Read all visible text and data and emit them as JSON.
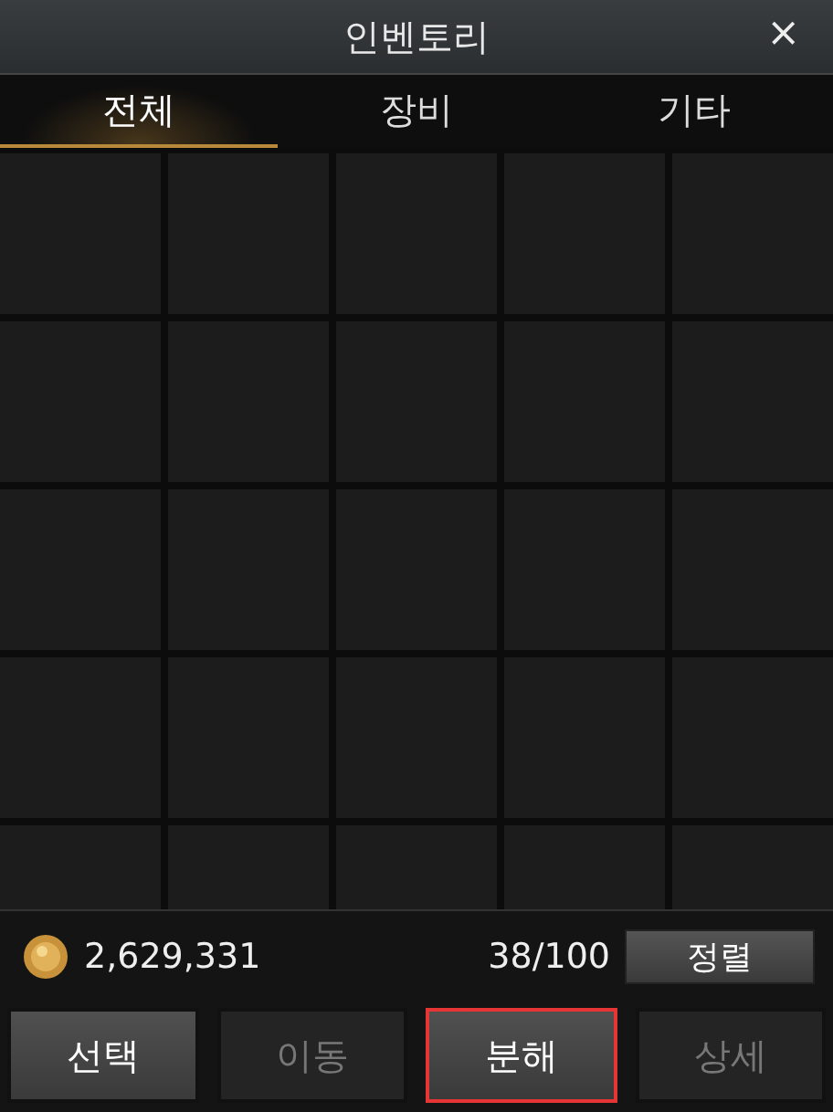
{
  "window": {
    "title": "인벤토리",
    "close": "×"
  },
  "tabs": [
    {
      "label": "전체",
      "selected": true
    },
    {
      "label": "장비",
      "selected": false
    },
    {
      "label": "기타",
      "selected": false
    }
  ],
  "slots": [
    {
      "empty": true
    },
    {
      "empty": true
    },
    {
      "empty": true
    },
    {
      "empty": true
    },
    {
      "empty": true
    },
    {
      "empty": true
    },
    {
      "empty": true
    },
    {
      "empty": true
    },
    {
      "empty": true
    },
    {
      "empty": true
    },
    {
      "empty": true
    },
    {
      "empty": true
    },
    {
      "empty": true
    },
    {
      "empty": true
    },
    {
      "empty": true
    },
    {
      "empty": true
    },
    {
      "empty": true
    },
    {
      "empty": true
    },
    {
      "empty": true
    },
    {
      "empty": true
    },
    {
      "empty": true
    },
    {
      "empty": true
    },
    {
      "empty": true
    },
    {
      "empty": true
    },
    {
      "empty": true
    }
  ],
  "currency": {
    "amount": "2,629,331"
  },
  "capacity": "38/100",
  "sort_button": "정렬",
  "buttons": [
    {
      "label": "선택",
      "disabled": false,
      "highlighted": false
    },
    {
      "label": "이동",
      "disabled": true,
      "highlighted": false
    },
    {
      "label": "분해",
      "disabled": false,
      "highlighted": true
    },
    {
      "label": "상세",
      "disabled": true,
      "highlighted": false
    }
  ]
}
